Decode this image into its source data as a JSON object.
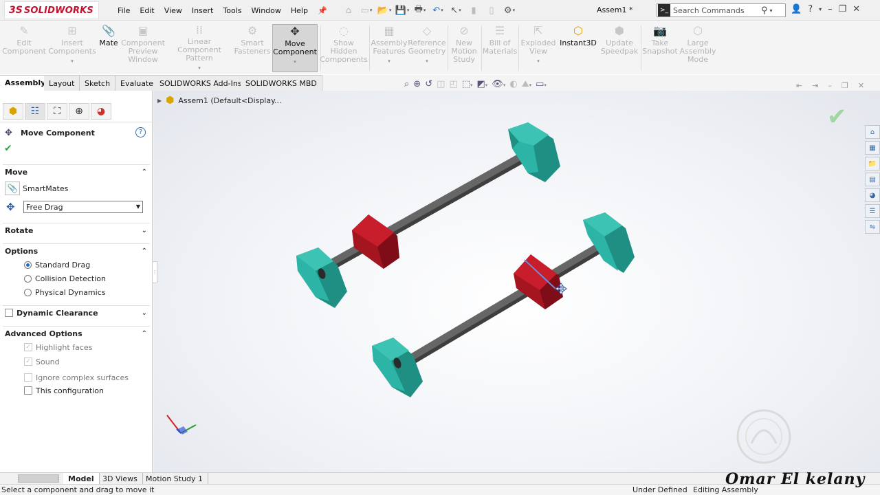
{
  "app": {
    "brand_prefix": "3S",
    "brand": "SOLIDWORKS",
    "document_title": "Assem1 *"
  },
  "menu": [
    "File",
    "Edit",
    "View",
    "Insert",
    "Tools",
    "Window",
    "Help"
  ],
  "search": {
    "placeholder": "Search Commands"
  },
  "ribbon": [
    {
      "label": "Edit Component",
      "icon": "edit-component-icon",
      "enabled": false
    },
    {
      "label": "Insert Components",
      "icon": "insert-components-icon",
      "enabled": false
    },
    {
      "label": "Mate",
      "icon": "mate-icon",
      "enabled": true
    },
    {
      "label": "Component Preview Window",
      "icon": "component-preview-icon",
      "enabled": false
    },
    {
      "label": "Linear Component Pattern",
      "icon": "linear-pattern-icon",
      "enabled": false
    },
    {
      "label": "Smart Fasteners",
      "icon": "smart-fasteners-icon",
      "enabled": false
    },
    {
      "label": "Move Component",
      "icon": "move-component-icon",
      "enabled": true,
      "pressed": true
    },
    {
      "label": "Show Hidden Components",
      "icon": "show-hidden-icon",
      "enabled": false
    },
    {
      "label": "Assembly Features",
      "icon": "assembly-features-icon",
      "enabled": false
    },
    {
      "label": "Reference Geometry",
      "icon": "reference-geometry-icon",
      "enabled": false
    },
    {
      "label": "New Motion Study",
      "icon": "motion-study-icon",
      "enabled": false
    },
    {
      "label": "Bill of Materials",
      "icon": "bom-icon",
      "enabled": false
    },
    {
      "label": "Exploded View",
      "icon": "exploded-view-icon",
      "enabled": false
    },
    {
      "label": "Instant3D",
      "icon": "instant3d-icon",
      "enabled": true
    },
    {
      "label": "Update Speedpak",
      "icon": "speedpak-icon",
      "enabled": false
    },
    {
      "label": "Take Snapshot",
      "icon": "snapshot-icon",
      "enabled": false
    },
    {
      "label": "Large Assembly Mode",
      "icon": "large-assembly-icon",
      "enabled": false
    }
  ],
  "tabs": [
    "Assembly",
    "Layout",
    "Sketch",
    "Evaluate",
    "SOLIDWORKS Add-Ins",
    "SOLIDWORKS MBD"
  ],
  "active_tab": "Assembly",
  "property_manager": {
    "title": "Move Component",
    "move": {
      "group": "Move",
      "smartmates": "SmartMates",
      "mode_value": "Free Drag"
    },
    "rotate": {
      "group": "Rotate"
    },
    "options": {
      "group": "Options",
      "items": [
        {
          "label": "Standard Drag",
          "selected": true
        },
        {
          "label": "Collision Detection",
          "selected": false
        },
        {
          "label": "Physical Dynamics",
          "selected": false
        }
      ]
    },
    "dynamic_clearance": {
      "group": "Dynamic Clearance"
    },
    "advanced": {
      "group": "Advanced Options",
      "items": [
        {
          "label": "Highlight faces",
          "checked": true,
          "enabled": false
        },
        {
          "label": "Sound",
          "checked": true,
          "enabled": false
        },
        {
          "label": "Ignore complex surfaces",
          "checked": false,
          "enabled": false
        },
        {
          "label": "This configuration",
          "checked": false,
          "enabled": true
        }
      ]
    }
  },
  "feature_tree": {
    "root_label": "Assem1  (Default<Display..."
  },
  "bottom_tabs": [
    "Model",
    "3D Views",
    "Motion Study 1"
  ],
  "status": {
    "hint": "Select a component and drag to move it",
    "state": "Under Defined",
    "mode": "Editing Assembly"
  },
  "watermark": "Omar  El kelany",
  "colors": {
    "plate": "#2cb5a7",
    "block": "#b01522",
    "rod": "#5d5d5d",
    "brand": "#c8102e"
  }
}
